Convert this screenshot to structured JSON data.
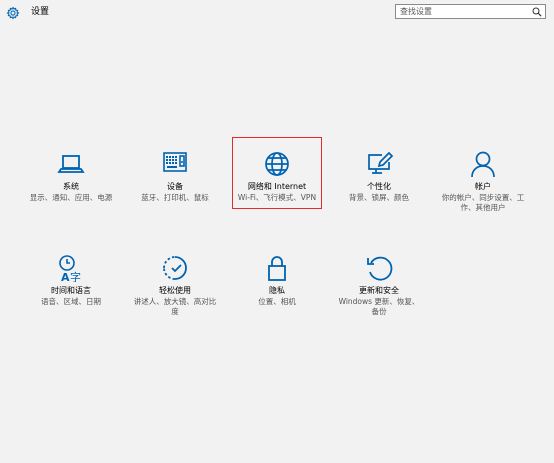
{
  "app": {
    "title": "设置",
    "icon": "gear-icon"
  },
  "search": {
    "placeholder": "查找设置",
    "icon": "search-icon"
  },
  "accent_color": "#0063b1",
  "highlight_color": "#e22b2b",
  "tiles": [
    {
      "label": "系统",
      "desc": "显示、通知、应用、电源",
      "icon": "laptop-icon"
    },
    {
      "label": "设备",
      "desc": "蓝牙、打印机、鼠标",
      "icon": "keyboard-printer-icon"
    },
    {
      "label": "网络和 Internet",
      "desc": "Wi-Fi、飞行模式、VPN",
      "icon": "globe-icon",
      "highlighted": true
    },
    {
      "label": "个性化",
      "desc": "背景、锁屏、颜色",
      "icon": "monitor-pen-icon"
    },
    {
      "label": "帐户",
      "desc": "你的帐户、同步设置、工作、其他用户",
      "icon": "person-icon"
    },
    {
      "label": "时间和语言",
      "desc": "语音、区域、日期",
      "icon": "time-language-icon"
    },
    {
      "label": "轻松使用",
      "desc": "讲述人、放大镜、高对比度",
      "icon": "ease-of-access-icon"
    },
    {
      "label": "隐私",
      "desc": "位置、相机",
      "icon": "lock-icon"
    },
    {
      "label": "更新和安全",
      "desc": "Windows 更新、恢复、备份",
      "icon": "refresh-icon"
    }
  ]
}
